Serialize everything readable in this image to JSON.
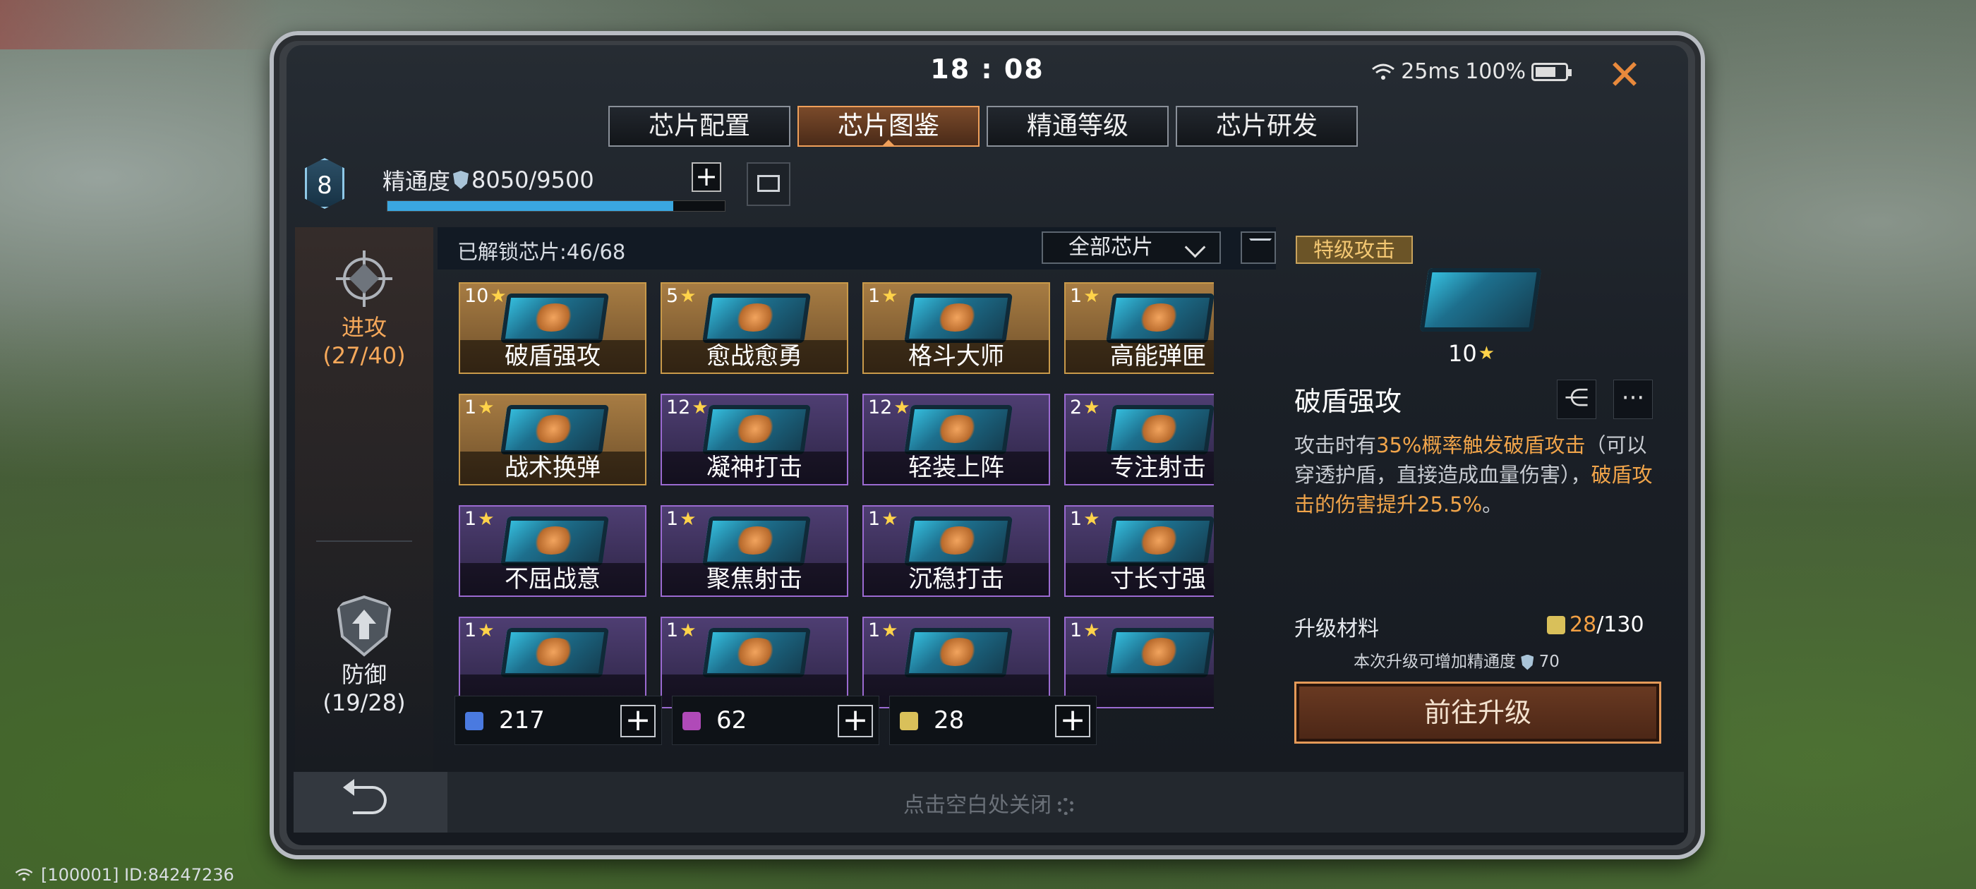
{
  "status": {
    "time": "18 : 08",
    "ping": "25ms",
    "battery": "100%"
  },
  "tabs": [
    {
      "label": "芯片配置",
      "active": false
    },
    {
      "label": "芯片图鉴",
      "active": true
    },
    {
      "label": "精通等级",
      "active": false
    },
    {
      "label": "芯片研发",
      "active": false
    }
  ],
  "mastery": {
    "level": "8",
    "label": "精通度",
    "value": "8050/9500",
    "progress": 0.847
  },
  "side_nav": [
    {
      "label": "进攻",
      "count": "(27/40)",
      "active": true
    },
    {
      "label": "防御",
      "count": "(19/28)",
      "active": false
    }
  ],
  "grid": {
    "unlocked": "已解锁芯片:46/68",
    "filter": "全部芯片",
    "cards": [
      {
        "level": "10",
        "name": "破盾强攻",
        "rarity": "gold"
      },
      {
        "level": "5",
        "name": "愈战愈勇",
        "rarity": "gold"
      },
      {
        "level": "1",
        "name": "格斗大师",
        "rarity": "gold"
      },
      {
        "level": "1",
        "name": "高能弹匣",
        "rarity": "gold"
      },
      {
        "level": "1",
        "name": "战术换弹",
        "rarity": "gold"
      },
      {
        "level": "12",
        "name": "凝神打击",
        "rarity": "purple"
      },
      {
        "level": "12",
        "name": "轻装上阵",
        "rarity": "purple"
      },
      {
        "level": "2",
        "name": "专注射击",
        "rarity": "purple"
      },
      {
        "level": "1",
        "name": "不屈战意",
        "rarity": "purple"
      },
      {
        "level": "1",
        "name": "聚焦射击",
        "rarity": "purple"
      },
      {
        "level": "1",
        "name": "沉稳打击",
        "rarity": "purple"
      },
      {
        "level": "1",
        "name": "寸长寸强",
        "rarity": "purple"
      },
      {
        "level": "1",
        "name": "",
        "rarity": "purple"
      },
      {
        "level": "1",
        "name": "",
        "rarity": "purple"
      },
      {
        "level": "1",
        "name": "",
        "rarity": "purple"
      },
      {
        "level": "1",
        "name": "",
        "rarity": "purple"
      }
    ]
  },
  "currencies": [
    {
      "value": "217",
      "color": "#4a7ae0"
    },
    {
      "value": "62",
      "color": "#b04ab8"
    },
    {
      "value": "28",
      "color": "#d9c05a"
    }
  ],
  "detail": {
    "type_tag": "特级攻击",
    "level": "10",
    "name": "破盾强攻",
    "desc_parts": [
      {
        "text": "攻击时有",
        "hl": false
      },
      {
        "text": "35%概率触发破盾攻击",
        "hl": true
      },
      {
        "text": "（可以穿透护盾，直接造成血量伤害），",
        "hl": false
      },
      {
        "text": "破盾攻击的伤害提升25.5%",
        "hl": true
      },
      {
        "text": "。",
        "hl": false
      }
    ],
    "material_label": "升级材料",
    "material_have": "28",
    "material_need": "/130",
    "upgrade_note_prefix": "本次升级可增加精通度",
    "upgrade_note_value": "70",
    "upgrade_button": "前往升级"
  },
  "bottom": {
    "hint": "点击空白处关闭"
  },
  "device_id": "[100001] ID:84247236"
}
